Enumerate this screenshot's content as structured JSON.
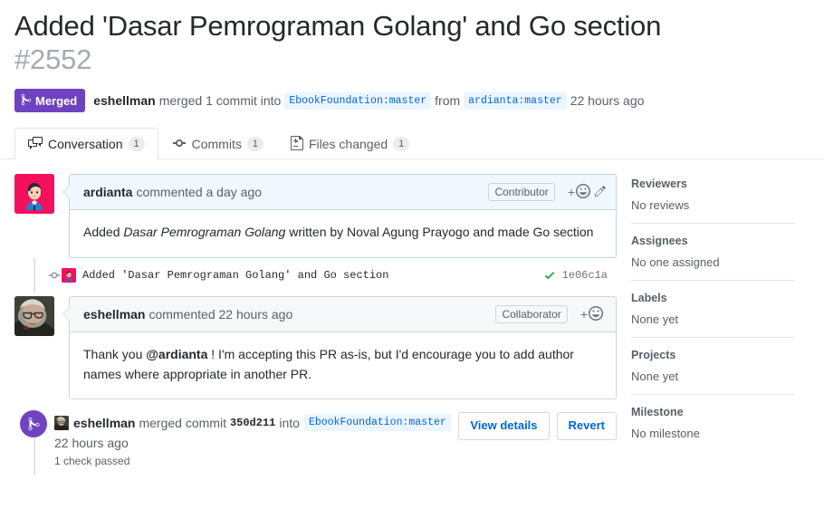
{
  "header": {
    "title": "Added 'Dasar Pemrograman Golang' and Go section",
    "number": "#2552",
    "state_label": "Merged",
    "merger": "eshellman",
    "merged_text": "merged 1 commit into",
    "base_branch": "EbookFoundation:master",
    "from_text": "from",
    "head_branch": "ardianta:master",
    "time": "22 hours ago"
  },
  "tabs": [
    {
      "label": "Conversation",
      "count": "1",
      "icon": "comment-discussion-icon",
      "selected": true
    },
    {
      "label": "Commits",
      "count": "1",
      "icon": "git-commit-icon",
      "selected": false
    },
    {
      "label": "Files changed",
      "count": "1",
      "icon": "file-diff-icon",
      "selected": false
    }
  ],
  "comments": [
    {
      "author": "ardianta",
      "meta": "commented a day ago",
      "role": "Contributor",
      "body_prefix": "Added ",
      "body_italic": "Dasar Pemrograman Golang",
      "body_suffix": " written by Noval Agung Prayogo and made Go section",
      "has_edit": true
    },
    {
      "author": "eshellman",
      "meta": "commented 22 hours ago",
      "role": "Collaborator",
      "body_prefix": "Thank you ",
      "body_mention": "@ardianta",
      "body_suffix": " ! I'm accepting this PR as-is, but I'd encourage you to add author names where appropriate in another PR.",
      "has_edit": false
    }
  ],
  "commit_row": {
    "message": "Added 'Dasar Pemrograman Golang' and Go section",
    "sha": "1e06c1a",
    "status": "check-passed"
  },
  "merge_event": {
    "user": "eshellman",
    "action": "merged commit",
    "sha": "350d211",
    "into": "into",
    "branch": "EbookFoundation:master",
    "time": "22 hours ago",
    "checks": "1 check passed",
    "view_details_label": "View details",
    "revert_label": "Revert"
  },
  "sidebar": [
    {
      "title": "Reviewers",
      "value": "No reviews"
    },
    {
      "title": "Assignees",
      "value": "No one assigned"
    },
    {
      "title": "Labels",
      "value": "None yet"
    },
    {
      "title": "Projects",
      "value": "None yet"
    },
    {
      "title": "Milestone",
      "value": "No milestone"
    }
  ],
  "colors": {
    "merged_purple": "#6f42c1",
    "link_blue": "#0366d6",
    "check_green": "#28a745",
    "number_gray": "#a3aab1"
  }
}
